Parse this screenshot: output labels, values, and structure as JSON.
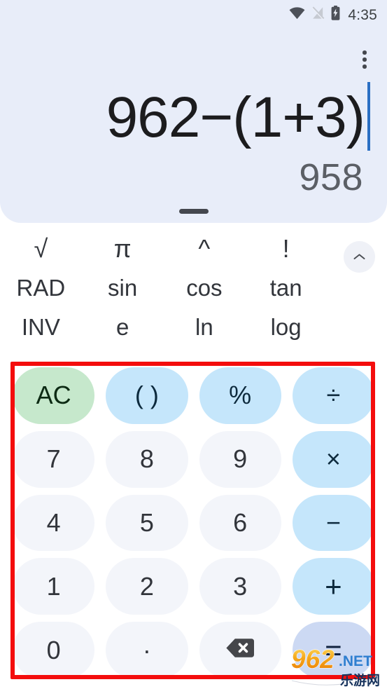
{
  "status_bar": {
    "time": "4:35",
    "icons": [
      "wifi-icon",
      "signal-off-icon",
      "battery-charging-icon"
    ]
  },
  "display": {
    "overflow_menu_label": "More options",
    "formula": "962−(1+3)",
    "result": "958",
    "drag_handle_label": "Drag handle"
  },
  "scientific_pad": {
    "collapse_label": "∧",
    "rows": [
      [
        {
          "label": "√",
          "name": "sqrt"
        },
        {
          "label": "π",
          "name": "pi"
        },
        {
          "label": "^",
          "name": "power"
        },
        {
          "label": "!",
          "name": "factorial"
        }
      ],
      [
        {
          "label": "RAD",
          "name": "rad"
        },
        {
          "label": "sin",
          "name": "sin"
        },
        {
          "label": "cos",
          "name": "cos"
        },
        {
          "label": "tan",
          "name": "tan"
        }
      ],
      [
        {
          "label": "INV",
          "name": "inv"
        },
        {
          "label": "e",
          "name": "e"
        },
        {
          "label": "ln",
          "name": "ln"
        },
        {
          "label": "log",
          "name": "log"
        }
      ]
    ]
  },
  "keypad": {
    "keys": [
      {
        "label": "AC",
        "name": "all-clear",
        "kind": "clear"
      },
      {
        "label": "( )",
        "name": "parentheses",
        "kind": "op"
      },
      {
        "label": "%",
        "name": "percent",
        "kind": "op"
      },
      {
        "label": "÷",
        "name": "divide",
        "kind": "op"
      },
      {
        "label": "7",
        "name": "seven",
        "kind": "digit"
      },
      {
        "label": "8",
        "name": "eight",
        "kind": "digit"
      },
      {
        "label": "9",
        "name": "nine",
        "kind": "digit"
      },
      {
        "label": "×",
        "name": "multiply",
        "kind": "op"
      },
      {
        "label": "4",
        "name": "four",
        "kind": "digit"
      },
      {
        "label": "5",
        "name": "five",
        "kind": "digit"
      },
      {
        "label": "6",
        "name": "six",
        "kind": "digit"
      },
      {
        "label": "−",
        "name": "minus",
        "kind": "op"
      },
      {
        "label": "1",
        "name": "one",
        "kind": "digit"
      },
      {
        "label": "2",
        "name": "two",
        "kind": "digit"
      },
      {
        "label": "3",
        "name": "three",
        "kind": "digit"
      },
      {
        "label": "+",
        "name": "plus",
        "kind": "op"
      },
      {
        "label": "0",
        "name": "zero",
        "kind": "digit"
      },
      {
        "label": "·",
        "name": "decimal",
        "kind": "digit"
      },
      {
        "label": "",
        "name": "backspace",
        "kind": "back"
      },
      {
        "label": "=",
        "name": "equals",
        "kind": "equals"
      }
    ]
  },
  "annotation": {
    "highlight_color": "#f40d0d",
    "target": "keypad"
  },
  "watermark": {
    "primary": "962",
    "secondary": ".NET",
    "subtitle": "乐游网",
    "primary_color": "#f0920e",
    "secondary_color": "#2f7fd0",
    "subtitle_color": "#16325c"
  }
}
